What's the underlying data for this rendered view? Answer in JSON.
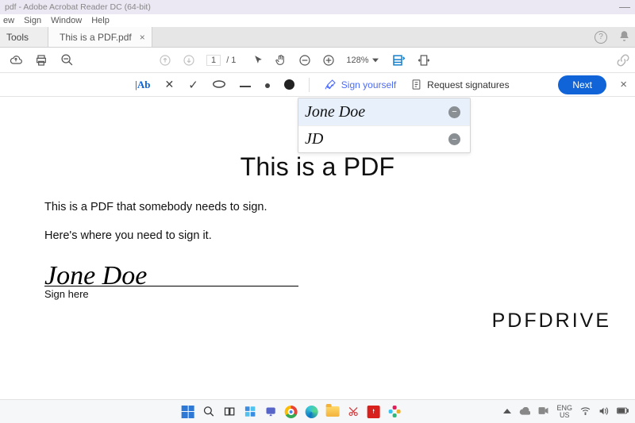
{
  "titlebar": {
    "text": "pdf - Adobe Acrobat Reader DC (64-bit)"
  },
  "menu": {
    "items": [
      "ew",
      "Sign",
      "Window",
      "Help"
    ]
  },
  "tabs": {
    "tools_label": "Tools",
    "doc_label": "This is a PDF.pdf"
  },
  "toolbar": {
    "page_current": "1",
    "page_total": "/  1",
    "zoom_label": "128%"
  },
  "signbar": {
    "sign_self": "Sign yourself",
    "request": "Request signatures",
    "next": "Next"
  },
  "sig_menu": {
    "full": "Jone Doe",
    "initials": "JD"
  },
  "document": {
    "title": "This is a PDF",
    "line1": "This is a PDF that somebody needs to sign.",
    "line2": "Here's where you need to sign it.",
    "signature": "Jone Doe",
    "caption": "Sign here"
  },
  "watermark": "PDFDRIVE",
  "tray": {
    "lang1": "ENG",
    "lang2": "US"
  }
}
